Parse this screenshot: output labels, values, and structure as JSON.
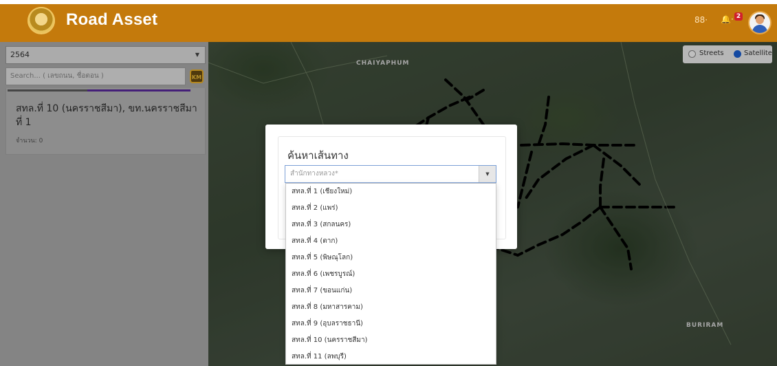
{
  "header": {
    "brand": "Road Asset",
    "apps_label": "88·",
    "bell_label": "🔔·",
    "notification_count": "2"
  },
  "sidebar": {
    "year_value": "2564",
    "search_placeholder": "Search... ( เลขถนน, ชื่อตอน )",
    "km_icon_label": "KM",
    "card": {
      "title": "สทล.ที่ 10 (นครราชสีมา), ขท.นครราชสีมา ที่ 1",
      "count": "จำนวน: 0"
    }
  },
  "map": {
    "places": [
      "CHAIYAPHUM",
      "BURIRAM"
    ],
    "layers": {
      "streets": "Streets",
      "satellite": "Satellite",
      "selected": "Satellite"
    }
  },
  "modal": {
    "title": "ค้นหาเส้นทาง",
    "select_placeholder": "สำนักทางหลวง*",
    "options": [
      "สทล.ที่ 1 (เชียงใหม่)",
      "สทล.ที่ 2 (แพร่)",
      "สทล.ที่ 3 (สกลนคร)",
      "สทล.ที่ 4 (ตาก)",
      "สทล.ที่ 5 (พิษณุโลก)",
      "สทล.ที่ 6 (เพชรบูรณ์)",
      "สทล.ที่ 7 (ขอนแก่น)",
      "สทล.ที่ 8 (มหาสารคาม)",
      "สทล.ที่ 9 (อุบลราชธานี)",
      "สทล.ที่ 10 (นครราชสีมา)",
      "สทล.ที่ 11 (ลพบุรี)"
    ]
  },
  "colors": {
    "header_bg": "#c47a0c",
    "route_line": "#000000",
    "selection_accent": "#5b2aa0"
  }
}
